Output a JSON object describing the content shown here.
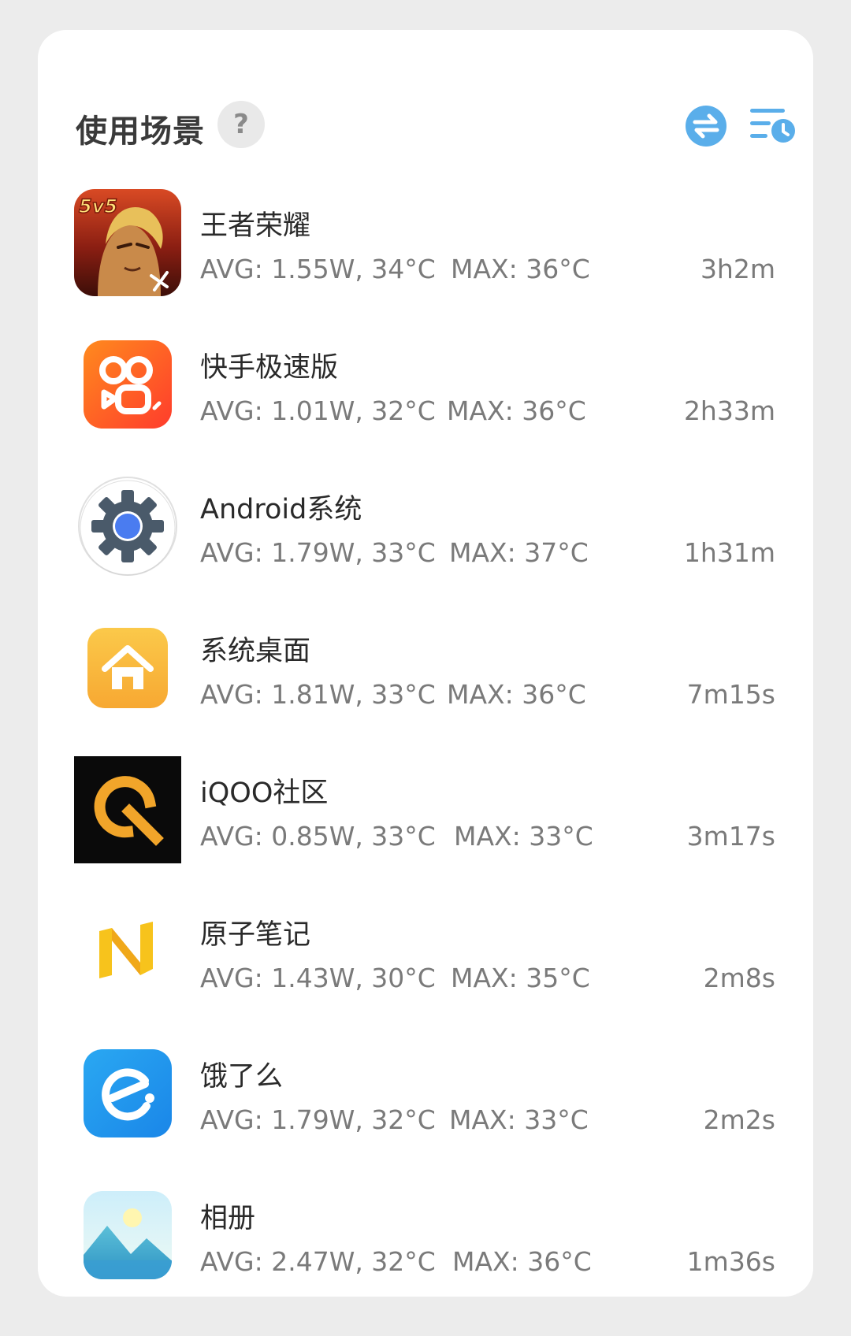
{
  "header": {
    "title": "使用场景",
    "help_label": "?",
    "accent_color": "#5aaeea"
  },
  "apps": [
    {
      "name": "王者荣耀",
      "avg": "AVG: 1.55W, 34°C",
      "max": "MAX:  36°C",
      "duration": "3h2m",
      "icon": "honor-of-kings-icon",
      "badge": "5v5"
    },
    {
      "name": "快手极速版",
      "avg": "AVG: 1.01W, 32°C",
      "max": "MAX:  36°C",
      "duration": "2h33m",
      "icon": "kuaishou-icon"
    },
    {
      "name": "Android系统",
      "avg": "AVG: 1.79W, 33°C",
      "max": "MAX:  37°C",
      "duration": "1h31m",
      "icon": "android-system-gear-icon"
    },
    {
      "name": "系统桌面",
      "avg": "AVG: 1.81W, 33°C",
      "max": "MAX:  36°C",
      "duration": "7m15s",
      "icon": "launcher-home-icon"
    },
    {
      "name": "iQOO社区",
      "avg": "AVG: 0.85W, 33°C",
      "max": "MAX:  33°C",
      "duration": "3m17s",
      "icon": "iqoo-community-icon"
    },
    {
      "name": "原子笔记",
      "avg": "AVG: 1.43W, 30°C",
      "max": "MAX:  35°C",
      "duration": "2m8s",
      "icon": "atom-notes-icon"
    },
    {
      "name": "饿了么",
      "avg": "AVG: 1.79W, 32°C",
      "max": "MAX:  33°C",
      "duration": "2m2s",
      "icon": "eleme-icon"
    },
    {
      "name": "相册",
      "avg": "AVG: 2.47W, 32°C",
      "max": "MAX:  36°C",
      "duration": "1m36s",
      "icon": "gallery-icon"
    }
  ]
}
